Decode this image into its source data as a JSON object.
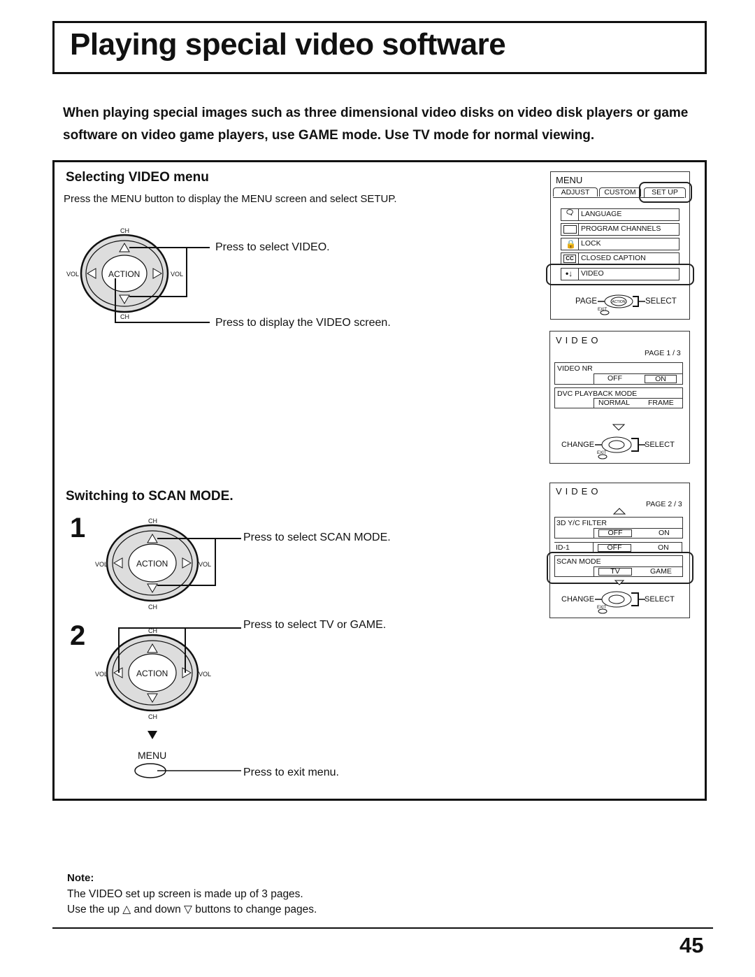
{
  "page": {
    "title": "Playing special video software",
    "intro": "When playing special images such as three dimensional video disks on video disk players or game software on video game players, use GAME mode. Use TV mode for normal viewing.",
    "page_number": "45"
  },
  "section1": {
    "heading": "Selecting VIDEO menu",
    "instruction": "Press the MENU button to display the MENU screen and select SETUP.",
    "remote": {
      "ch_top": "CH",
      "ch_bottom": "CH",
      "vol_left": "VOL",
      "vol_right": "VOL",
      "center": "ACTION"
    },
    "callouts": [
      "Press to select VIDEO.",
      "Press to display the VIDEO screen."
    ]
  },
  "section2": {
    "heading": "Switching to SCAN MODE.",
    "step1": {
      "number": "1",
      "remote": {
        "ch_top": "CH",
        "ch_bottom": "CH",
        "vol_left": "VOL",
        "vol_right": "VOL",
        "center": "ACTION"
      },
      "callout": "Press to select SCAN MODE."
    },
    "step2": {
      "number": "2",
      "remote": {
        "ch_top": "CH",
        "ch_bottom": "CH",
        "vol_left": "VOL",
        "vol_right": "VOL",
        "center": "ACTION"
      },
      "callout": "Press to select TV or GAME.",
      "menu_button_label": "MENU",
      "menu_callout": "Press to exit menu."
    }
  },
  "menu_screen": {
    "title": "MENU",
    "tabs": [
      "ADJUST",
      "CUSTOM",
      "SET UP"
    ],
    "selected_tab": "SET UP",
    "items": [
      {
        "label": "LANGUAGE",
        "icon": "language-icon"
      },
      {
        "label": "PROGRAM  CHANNELS",
        "icon": "tv-screen-icon"
      },
      {
        "label": "LOCK",
        "icon": "lock-icon"
      },
      {
        "label": "CLOSED  CAPTION",
        "icon": "cc-icon"
      },
      {
        "label": "VIDEO",
        "icon": "video-icon"
      }
    ],
    "selected_item": "VIDEO",
    "nav": {
      "left": "PAGE",
      "center": "ACTION",
      "right": "SELECT",
      "exit": "EXIT"
    }
  },
  "video_page1": {
    "title": "VIDEO",
    "page": "PAGE 1 / 3",
    "settings": [
      {
        "label": "VIDEO  NR",
        "options": [
          "OFF",
          "ON"
        ],
        "selected": "ON"
      },
      {
        "label": "DVC  PLAYBACK  MODE",
        "options": [
          "NORMAL",
          "FRAME"
        ],
        "selected": "FRAME"
      }
    ],
    "nav": {
      "left": "CHANGE",
      "right": "SELECT",
      "exit": "EXIT"
    }
  },
  "video_page2": {
    "title": "VIDEO",
    "page": "PAGE 2 / 3",
    "settings": [
      {
        "label": "3D Y/C FILTER",
        "options": [
          "OFF",
          "ON"
        ],
        "selected": "OFF"
      },
      {
        "label": "ID-1",
        "options": [
          "OFF",
          "ON"
        ],
        "selected": "OFF"
      },
      {
        "label": "SCAN  MODE",
        "options": [
          "TV",
          "GAME"
        ],
        "selected": "TV"
      }
    ],
    "highlighted": "SCAN  MODE",
    "nav": {
      "left": "CHANGE",
      "right": "SELECT",
      "exit": "EXIT"
    }
  },
  "note": {
    "title": "Note:",
    "lines": [
      "The VIDEO set up screen is made up of 3 pages.",
      "Use the up △ and down ▽ buttons to change pages."
    ]
  }
}
